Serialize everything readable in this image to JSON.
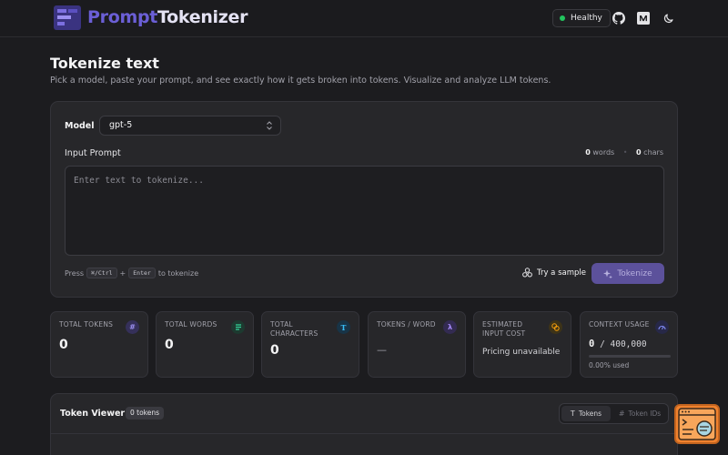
{
  "header": {
    "brand_part1": "Prompt",
    "brand_part2": "Tokenizer",
    "status_label": "Healthy",
    "icons": [
      "logo-icon",
      "github-icon",
      "medium-icon",
      "moon-icon"
    ]
  },
  "page": {
    "title": "Tokenize text",
    "subtitle": "Pick a model, paste your prompt, and see exactly how it gets broken into tokens. Visualize and analyze LLM tokens."
  },
  "form": {
    "model_label": "Model",
    "model_value": "gpt-5",
    "prompt_label": "Input Prompt",
    "words_count": "0",
    "words_unit": "words",
    "chars_count": "0",
    "chars_unit": "chars",
    "placeholder": "Enter text to tokenize...",
    "hint_press": "Press",
    "hint_key1": "⌘/Ctrl",
    "hint_plus": "+",
    "hint_key2": "Enter",
    "hint_to": "to tokenize",
    "sample_label": "Try a sample",
    "tokenize_label": "Tokenize"
  },
  "stats": {
    "total_tokens_label": "TOTAL TOKENS",
    "total_tokens_value": "0",
    "total_words_label": "TOTAL WORDS",
    "total_words_value": "0",
    "total_chars_label": "TOTAL CHARACTERS",
    "total_chars_value": "0",
    "tokens_per_word_label": "TOKENS / WORD",
    "tokens_per_word_value": "—",
    "cost_label": "ESTIMATED INPUT COST",
    "cost_value": "Pricing unavailable",
    "context_label": "CONTEXT USAGE",
    "context_used": "0",
    "context_total": "/ 400,000",
    "context_percent_text": "0.00% used",
    "context_fraction": 0.0
  },
  "viewer": {
    "title": "Token Viewer",
    "badge": "0 tokens",
    "tab_tokens": "Tokens",
    "tab_ids": "Token IDs"
  },
  "colors": {
    "accent": "#6b5fd6",
    "healthy": "#22c55e",
    "float_button": "#f0822e"
  }
}
